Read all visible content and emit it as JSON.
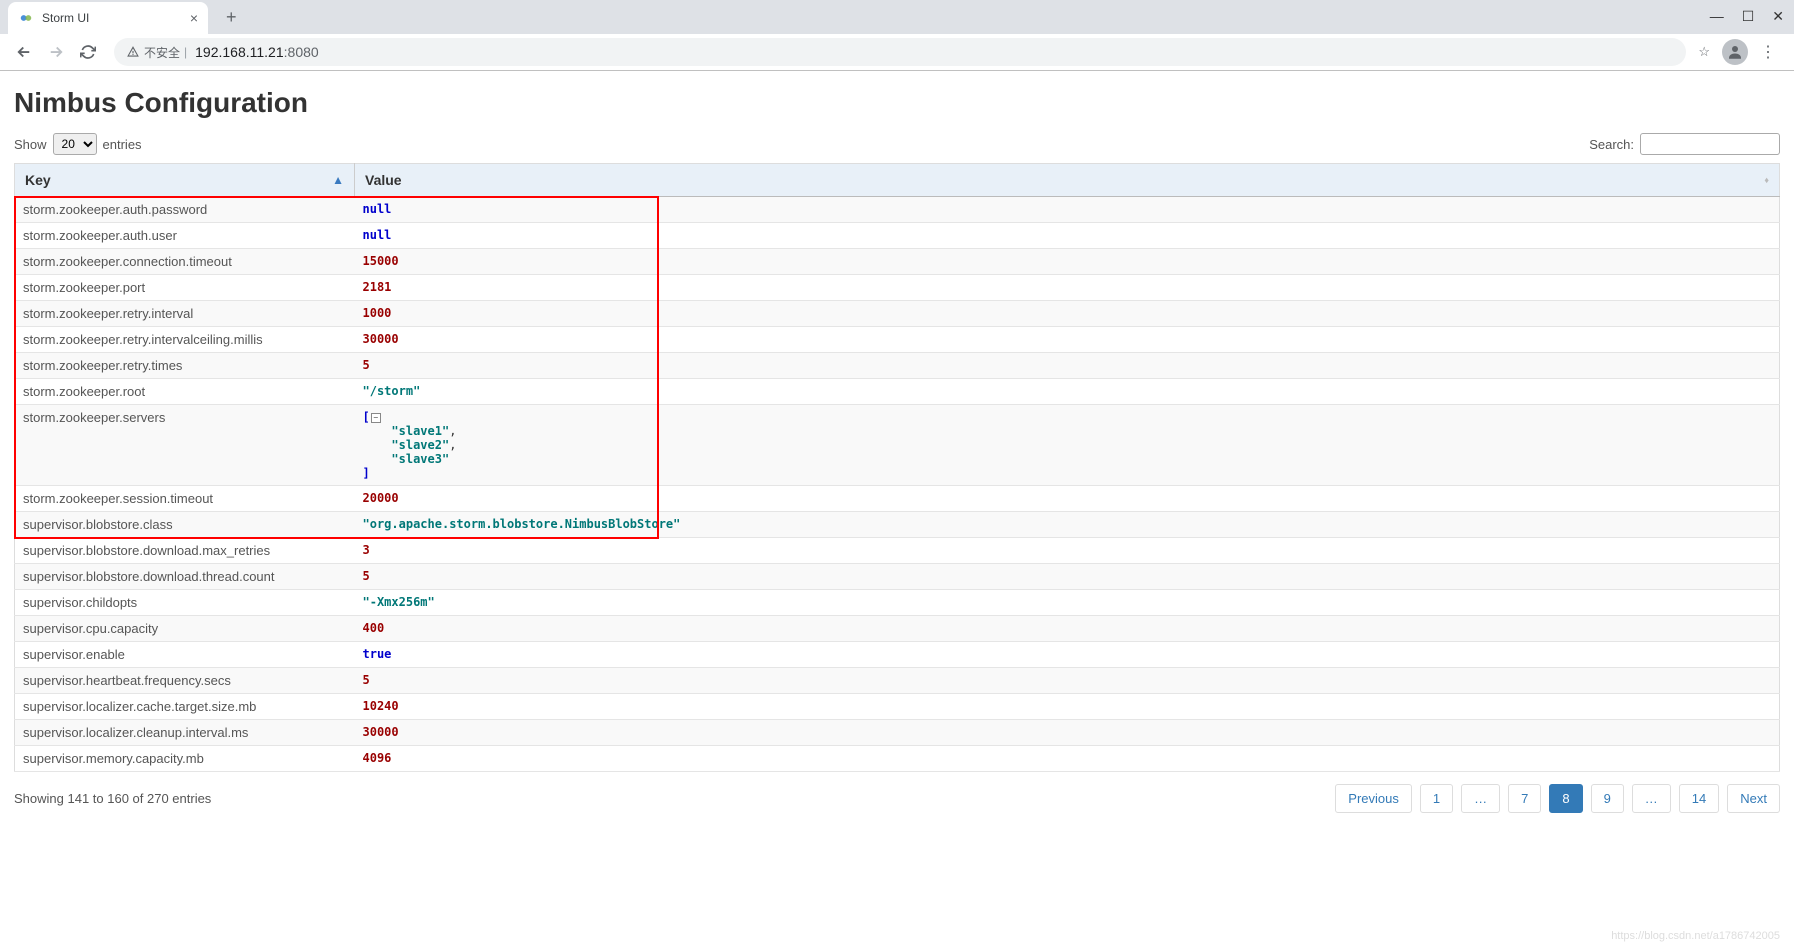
{
  "browser": {
    "tab_title": "Storm UI",
    "security_text": "不安全",
    "url_host": "192.168.11.21",
    "url_port": ":8080"
  },
  "page": {
    "heading": "Nimbus Configuration",
    "show_label": "Show",
    "show_value": "20",
    "entries_label": "entries",
    "search_label": "Search:",
    "col_key": "Key",
    "col_value": "Value",
    "footer_info": "Showing 141 to 160 of 270 entries",
    "watermark": "https://blog.csdn.net/a1786742005"
  },
  "rows": [
    {
      "key": "storm.zookeeper.auth.password",
      "value": {
        "type": "null",
        "text": "null"
      },
      "hl": true
    },
    {
      "key": "storm.zookeeper.auth.user",
      "value": {
        "type": "null",
        "text": "null"
      },
      "hl": true
    },
    {
      "key": "storm.zookeeper.connection.timeout",
      "value": {
        "type": "number",
        "text": "15000"
      },
      "hl": true
    },
    {
      "key": "storm.zookeeper.port",
      "value": {
        "type": "number",
        "text": "2181"
      },
      "hl": true
    },
    {
      "key": "storm.zookeeper.retry.interval",
      "value": {
        "type": "number",
        "text": "1000"
      },
      "hl": true
    },
    {
      "key": "storm.zookeeper.retry.intervalceiling.millis",
      "value": {
        "type": "number",
        "text": "30000"
      },
      "hl": true
    },
    {
      "key": "storm.zookeeper.retry.times",
      "value": {
        "type": "number",
        "text": "5"
      },
      "hl": true
    },
    {
      "key": "storm.zookeeper.root",
      "value": {
        "type": "string",
        "text": "\"/storm\""
      },
      "hl": true
    },
    {
      "key": "storm.zookeeper.servers",
      "value": {
        "type": "array",
        "items": [
          "\"slave1\"",
          "\"slave2\"",
          "\"slave3\""
        ]
      },
      "hl": true
    },
    {
      "key": "storm.zookeeper.session.timeout",
      "value": {
        "type": "number",
        "text": "20000"
      },
      "hl": true
    },
    {
      "key": "supervisor.blobstore.class",
      "value": {
        "type": "string",
        "text": "\"org.apache.storm.blobstore.NimbusBlobStore\""
      },
      "hl": true
    },
    {
      "key": "supervisor.blobstore.download.max_retries",
      "value": {
        "type": "number",
        "text": "3"
      }
    },
    {
      "key": "supervisor.blobstore.download.thread.count",
      "value": {
        "type": "number",
        "text": "5"
      }
    },
    {
      "key": "supervisor.childopts",
      "value": {
        "type": "string",
        "text": "\"-Xmx256m\""
      }
    },
    {
      "key": "supervisor.cpu.capacity",
      "value": {
        "type": "number",
        "text": "400"
      }
    },
    {
      "key": "supervisor.enable",
      "value": {
        "type": "bool",
        "text": "true"
      }
    },
    {
      "key": "supervisor.heartbeat.frequency.secs",
      "value": {
        "type": "number",
        "text": "5"
      }
    },
    {
      "key": "supervisor.localizer.cache.target.size.mb",
      "value": {
        "type": "number",
        "text": "10240"
      }
    },
    {
      "key": "supervisor.localizer.cleanup.interval.ms",
      "value": {
        "type": "number",
        "text": "30000"
      }
    },
    {
      "key": "supervisor.memory.capacity.mb",
      "value": {
        "type": "number",
        "text": "4096"
      }
    }
  ],
  "pagination": {
    "prev": "Previous",
    "next": "Next",
    "pages": [
      "1",
      "…",
      "7",
      "8",
      "9",
      "…",
      "14"
    ],
    "active": "8"
  }
}
